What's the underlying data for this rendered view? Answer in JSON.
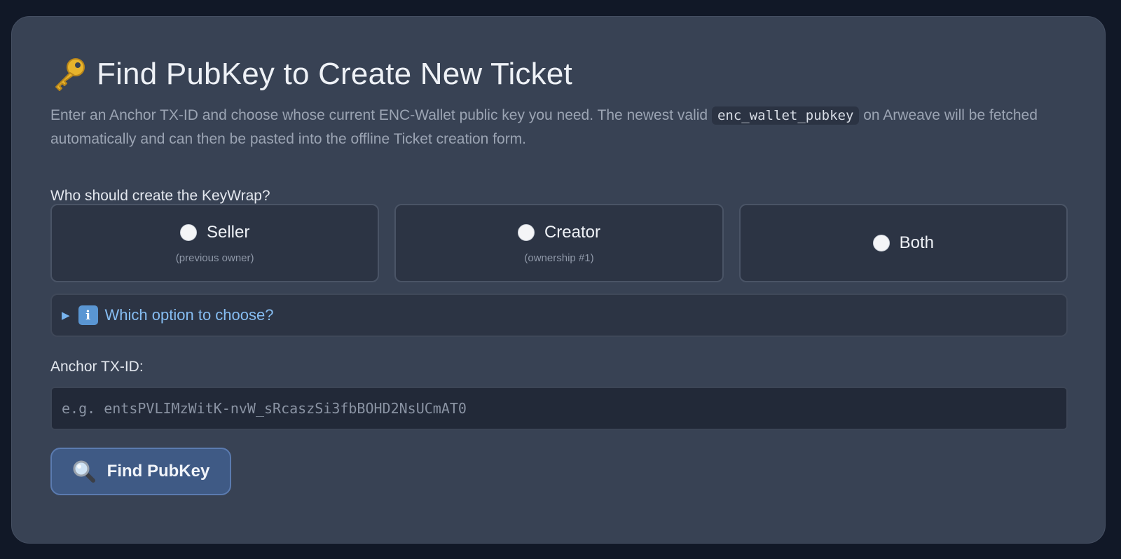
{
  "header": {
    "title": "Find PubKey to Create New Ticket",
    "title_icon": "key-icon"
  },
  "description": {
    "part1": "Enter an Anchor TX-ID and choose whose current ENC-Wallet public key you need. The newest valid ",
    "code": "enc_wallet_pubkey",
    "part2": " on Arweave will be fetched automatically and can then be pasted into the offline Ticket creation form."
  },
  "keywrap": {
    "question": "Who should create the KeyWrap?",
    "options": [
      {
        "label": "Seller",
        "sublabel": "(previous owner)",
        "selected": false
      },
      {
        "label": "Creator",
        "sublabel": "(ownership #1)",
        "selected": false
      },
      {
        "label": "Both",
        "sublabel": "",
        "selected": false
      }
    ]
  },
  "help": {
    "summary": "Which option to choose?",
    "icon": "info-icon",
    "expanded": false
  },
  "anchor": {
    "label": "Anchor TX-ID:",
    "value": "",
    "placeholder": "e.g. entsPVLIMzWitK-nvW_sRcaszSi3fbBOHD2NsUCmAT0"
  },
  "action": {
    "find_label": "Find PubKey",
    "icon": "magnifier-icon"
  },
  "colors": {
    "background": "#111827",
    "card": "#384254",
    "accent_link": "#86bdf2",
    "button": "#3f5a85"
  }
}
